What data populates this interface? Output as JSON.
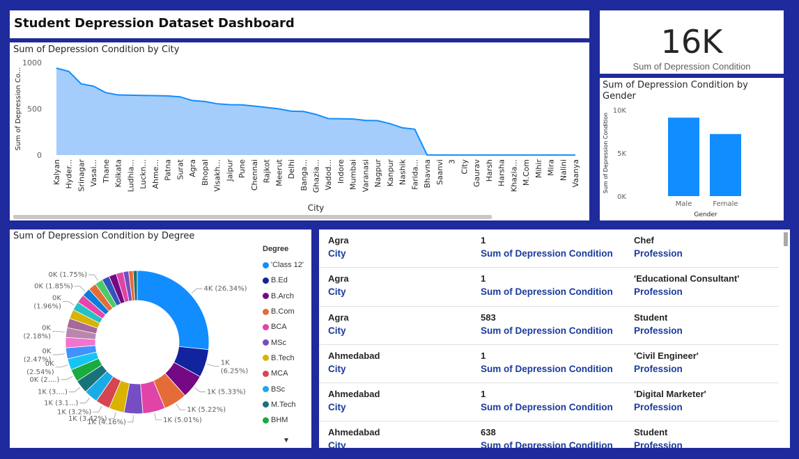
{
  "dashboard": {
    "title": "Student Depression Dataset Dashboard"
  },
  "kpi": {
    "value": "16K",
    "label": "Sum of Depression Condition"
  },
  "city_chart": {
    "title": "Sum of Depression Condition by City"
  },
  "gender_chart": {
    "title": "Sum of Depression Condition by Gender"
  },
  "degree_chart": {
    "title": "Sum of Depression Condition by Degree",
    "legend_title": "Degree"
  },
  "table": {
    "rows": [
      {
        "city": "Agra",
        "sum": "1",
        "profession": "Chef"
      },
      {
        "city": "Agra",
        "sum": "1",
        "profession": "'Educational Consultant'"
      },
      {
        "city": "Agra",
        "sum": "583",
        "profession": "Student"
      },
      {
        "city": "Ahmedabad",
        "sum": "1",
        "profession": "'Civil Engineer'"
      },
      {
        "city": "Ahmedabad",
        "sum": "1",
        "profession": "'Digital Marketer'"
      },
      {
        "city": "Ahmedabad",
        "sum": "638",
        "profession": "Student"
      }
    ],
    "labels": {
      "city": "City",
      "sum": "Sum of Depression Condition",
      "profession": "Profession"
    }
  },
  "colors": {
    "background": "#1f2a9c",
    "area": "#a5cdfb",
    "area_line": "#118dff",
    "bar": "#118dff"
  },
  "chart_data": [
    {
      "type": "area",
      "title": "Sum of Depression Condition by City",
      "xlabel": "City",
      "ylabel": "Sum of Depression Co...",
      "ylim": [
        0,
        1000
      ],
      "yticks": [
        "0",
        "500",
        "1000"
      ],
      "categories": [
        "Kalyan",
        "Hyder...",
        "Srinagar",
        "Vasai...",
        "Thane",
        "Kolkata",
        "Ludhia...",
        "Luckn...",
        "Ahme...",
        "Patna",
        "Surat",
        "Agra",
        "Bhopal",
        "Visakh...",
        "Jaipur",
        "Pune",
        "Chennai",
        "Rajkot",
        "Meerut",
        "Delhi",
        "Banga...",
        "Ghazia...",
        "Vadod...",
        "Indore",
        "Mumbai",
        "Varanasi",
        "Nagpur",
        "Kanpur",
        "Nashik",
        "Farida...",
        "Bhavna",
        "Saanvi",
        "3",
        "City",
        "Gaurav",
        "Harsh",
        "Harsha",
        "Khazia...",
        "M.Com",
        "Mihir",
        "Mira",
        "Nalini",
        "Vaanya"
      ],
      "values": [
        940,
        905,
        770,
        745,
        675,
        650,
        648,
        645,
        643,
        640,
        630,
        590,
        580,
        555,
        545,
        543,
        530,
        515,
        500,
        475,
        472,
        440,
        395,
        393,
        390,
        375,
        372,
        340,
        295,
        280,
        1,
        1,
        1,
        1,
        1,
        1,
        1,
        1,
        1,
        1,
        1,
        1,
        1
      ],
      "grid": false
    },
    {
      "type": "bar",
      "title": "Sum of Depression Condition by Gender",
      "xlabel": "Gender",
      "ylabel": "Sum of Depression Condition",
      "ylim": [
        0,
        10000
      ],
      "yticks": [
        "0K",
        "5K",
        "10K"
      ],
      "categories": [
        "Male",
        "Female"
      ],
      "values": [
        9100,
        7200
      ]
    },
    {
      "type": "pie",
      "variant": "donut",
      "title": "Sum of Depression Condition by Degree",
      "legend_title": "Degree",
      "legend_placement": "right",
      "legend": [
        "'Class 12'",
        "B.Ed",
        "B.Arch",
        "B.Com",
        "BCA",
        "MSc",
        "B.Tech",
        "MCA",
        "BSc",
        "M.Tech",
        "BHM"
      ],
      "slices": [
        {
          "label": "'Class 12'",
          "pct": 26.34,
          "text": "4K (26.34%)",
          "color": "#118dff"
        },
        {
          "label": "B.Ed",
          "pct": 6.25,
          "text": "1K (6.25%)",
          "color": "#12239e"
        },
        {
          "label": "B.Arch",
          "pct": 5.33,
          "text": "1K (5.33%)",
          "color": "#750985"
        },
        {
          "label": "B.Com",
          "pct": 5.22,
          "text": "1K (5.22%)",
          "color": "#e66c37"
        },
        {
          "label": "BCA",
          "pct": 5.01,
          "text": "1K (5.01%)",
          "color": "#e044a7"
        },
        {
          "label": "MSc",
          "pct": 4.16,
          "text": "1K (4.16%)",
          "color": "#744ec2"
        },
        {
          "label": "B.Tech",
          "pct": 3.42,
          "text": "1K (3.42%)",
          "color": "#d9b300"
        },
        {
          "label": "MCA",
          "pct": 3.2,
          "text": "1K (3.2%)",
          "color": "#d64550"
        },
        {
          "label": "BSc",
          "pct": 3.1,
          "text": "1K (3.1...)",
          "color": "#1aabe6"
        },
        {
          "label": "M.Tech",
          "pct": 3.0,
          "text": "1K (3....)",
          "color": "#197278"
        },
        {
          "label": "BHM",
          "pct": 2.8,
          "text": "0K (2....)",
          "color": "#1aab40"
        },
        {
          "pct": 2.54,
          "text": "0K (2.54%)",
          "color": "#15c6f4"
        },
        {
          "pct": 2.47,
          "text": "0K (2.47%)",
          "color": "#4092ff"
        },
        {
          "pct": 2.3,
          "text": "",
          "color": "#f472d0"
        },
        {
          "pct": 2.18,
          "text": "0K (2.18%)",
          "color": "#b887ad"
        },
        {
          "pct": 2.1,
          "text": "",
          "color": "#a66999"
        },
        {
          "pct": 2.05,
          "text": "",
          "color": "#d9b300"
        },
        {
          "pct": 1.96,
          "text": "0K (1.96%)",
          "color": "#25c1c4"
        },
        {
          "pct": 1.9,
          "text": "",
          "color": "#e645a9"
        },
        {
          "pct": 1.85,
          "text": "0K (1.85%)",
          "color": "#0a7ddb"
        },
        {
          "pct": 1.8,
          "text": "",
          "color": "#e66c37"
        },
        {
          "pct": 1.75,
          "text": "0K (1.75%)",
          "color": "#4ec96a"
        },
        {
          "pct": 1.7,
          "text": "",
          "color": "#3355bb"
        },
        {
          "pct": 1.65,
          "text": "",
          "color": "#750985"
        },
        {
          "pct": 1.6,
          "text": "",
          "color": "#e044a7"
        },
        {
          "pct": 1.2,
          "text": "",
          "color": "#744ec2"
        },
        {
          "pct": 1.0,
          "text": "",
          "color": "#e66c37"
        },
        {
          "pct": 0.9,
          "text": "",
          "color": "#197278"
        }
      ]
    }
  ]
}
